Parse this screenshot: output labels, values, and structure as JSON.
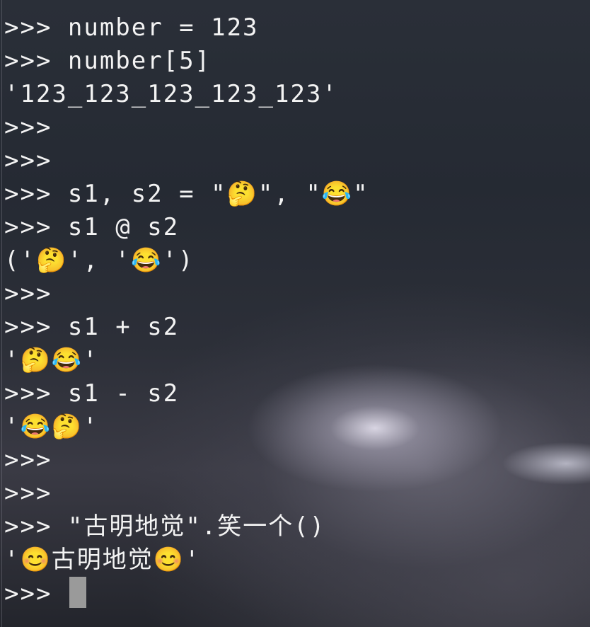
{
  "terminal": {
    "lines": [
      ">>> number = 123",
      ">>> number[5]",
      "'123_123_123_123_123'",
      ">>>",
      ">>>",
      ">>> s1, s2 = \"🤔\", \"😂\"",
      ">>> s1 @ s2",
      "('🤔', '😂')",
      ">>>",
      ">>> s1 + s2",
      "'🤔😂'",
      ">>> s1 - s2",
      "'😂🤔'",
      ">>>",
      ">>>",
      ">>> \"古明地觉\".笑一个()",
      "'😊古明地觉😊'",
      ">>> "
    ]
  },
  "colors": {
    "text": "#f3f3f3",
    "cursor": "#9a9a9a",
    "background": "#1f2229"
  }
}
